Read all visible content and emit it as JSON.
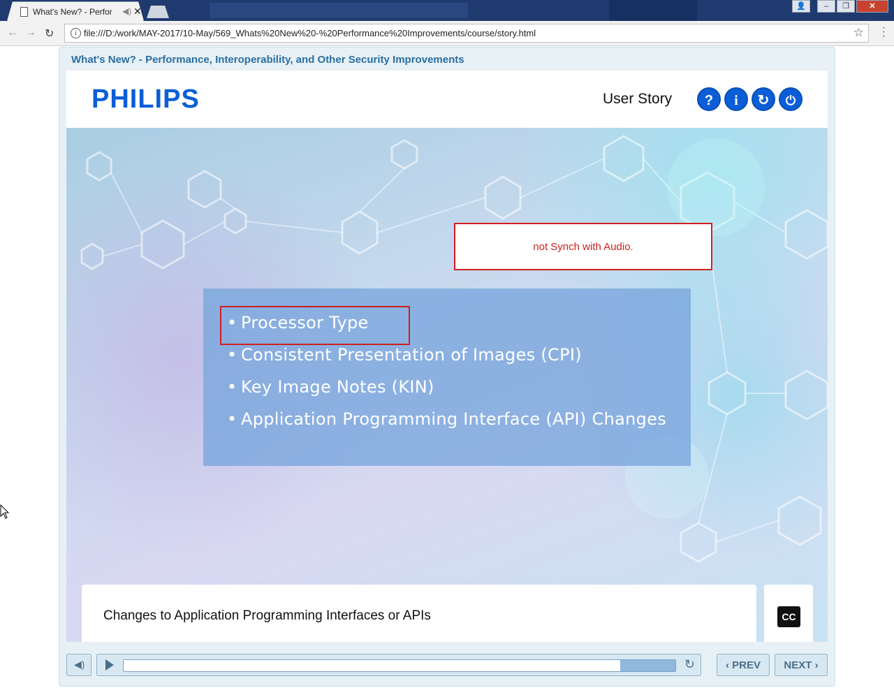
{
  "browser": {
    "tab_title": "What's New? - Perfor",
    "tab_close": "✕",
    "url": "file:///D:/work/MAY-2017/10-May/569_Whats%20New%20-%20Performance%20Improvements/course/story.html",
    "info_icon": "i"
  },
  "player": {
    "course_title": "What's New? - Performance, Interoperability, and Other Security Improvements",
    "logo": "PHILIPS",
    "user_story": "User Story",
    "buttons": [
      {
        "icon": "help-icon",
        "glyph": "?"
      },
      {
        "icon": "info-icon",
        "glyph": "i"
      },
      {
        "icon": "replay-icon",
        "glyph": "↻"
      },
      {
        "icon": "power-icon",
        "glyph": "⏻"
      }
    ]
  },
  "slide": {
    "note": "not Synch with Audio.",
    "bullets": [
      "Processor Type",
      "Consistent Presentation of Images (CPI)",
      "Key Image Notes (KIN)",
      "Application Programming Interface (API) Changes"
    ],
    "caption": "Changes to Application Programming Interfaces or APIs",
    "cc_label": "CC"
  },
  "controls": {
    "progress_fraction": 0.9,
    "prev_label": "‹ PREV",
    "next_label": "NEXT ›"
  },
  "colors": {
    "brand_blue": "#0b5ed7",
    "annotation_red": "#d01f1f",
    "title_blue": "#2a6ea3"
  }
}
